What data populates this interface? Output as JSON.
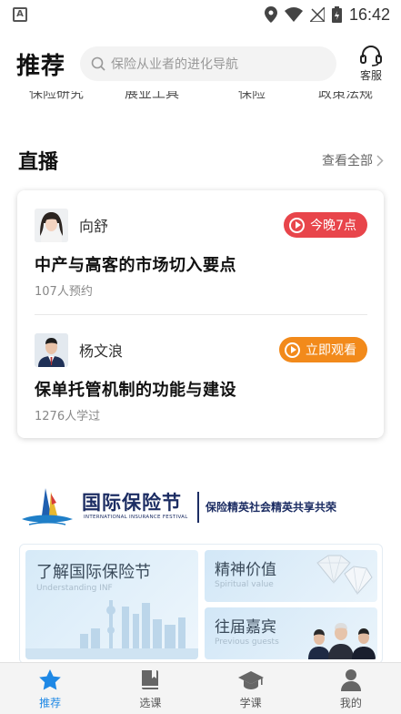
{
  "status_bar": {
    "time": "16:42",
    "notification_icon": "A"
  },
  "header": {
    "title": "推荐",
    "search_placeholder": "保险从业者的进化导航",
    "service_label": "客服"
  },
  "cut_row_labels": [
    "保险研究",
    "展业工具",
    "保险",
    "政策法规"
  ],
  "live": {
    "section_title": "直播",
    "see_all": "查看全部",
    "items": [
      {
        "host": "向舒",
        "badge": "今晚7点",
        "badge_color": "#e8454b",
        "title": "中产与高客的市场切入要点",
        "meta": "107人预约"
      },
      {
        "host": "杨文浪",
        "badge": "立即观看",
        "badge_color": "#f28a1b",
        "title": "保单托管机制的功能与建设",
        "meta": "1276人学过"
      }
    ]
  },
  "festival": {
    "name_cn": "国际保险节",
    "name_en": "INTERNATIONAL INSURANCE FESTIVAL",
    "slogan": "保险精英社会精英共享共荣",
    "tiles": [
      {
        "title": "了解国际保险节",
        "subtitle": "Understanding INF"
      },
      {
        "title": "精神价值",
        "subtitle": "Spiritual value"
      },
      {
        "title": "往届嘉宾",
        "subtitle": "Previous guests"
      }
    ]
  },
  "bottom_nav": {
    "items": [
      {
        "label": "推荐",
        "icon": "star-icon",
        "active": true
      },
      {
        "label": "选课",
        "icon": "book-icon",
        "active": false
      },
      {
        "label": "学课",
        "icon": "graduation-cap-icon",
        "active": false
      },
      {
        "label": "我的",
        "icon": "person-icon",
        "active": false
      }
    ]
  },
  "colors": {
    "accent": "#1e88e5",
    "live_red": "#e8454b",
    "live_orange": "#f28a1b",
    "festival_navy": "#1c2d63"
  }
}
